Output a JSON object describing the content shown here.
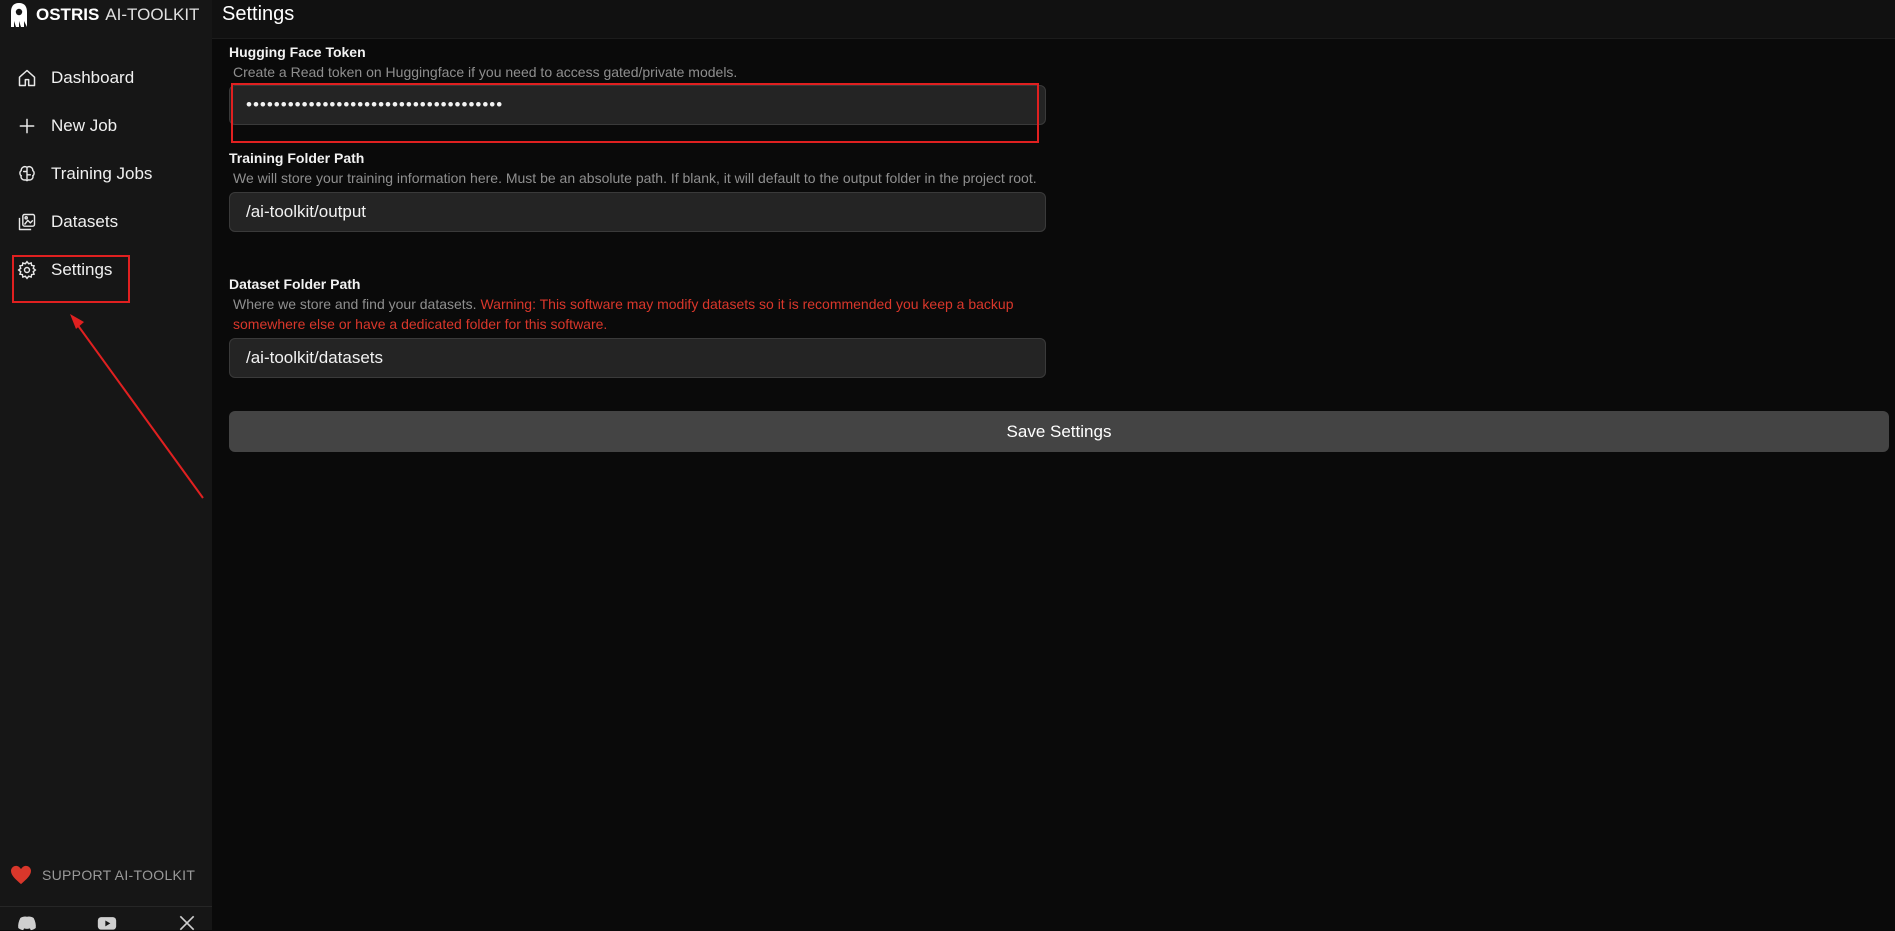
{
  "brand": {
    "name_bold": "OSTRIS",
    "name_rest": "AI-TOOLKIT"
  },
  "header": {
    "title": "Settings"
  },
  "sidebar": {
    "items": [
      {
        "label": "Dashboard",
        "icon": "home-icon"
      },
      {
        "label": "New Job",
        "icon": "plus-icon"
      },
      {
        "label": "Training Jobs",
        "icon": "brain-icon"
      },
      {
        "label": "Datasets",
        "icon": "images-icon"
      },
      {
        "label": "Settings",
        "icon": "gear-icon"
      }
    ],
    "support_label": "SUPPORT AI-TOOLKIT",
    "socials": [
      "discord-icon",
      "youtube-icon",
      "x-icon"
    ]
  },
  "form": {
    "hf_token": {
      "label": "Hugging Face Token",
      "help": "Create a Read token on Huggingface if you need to access gated/private models.",
      "value": "•••••••••••••••••••••••••••••••••••••"
    },
    "training_folder": {
      "label": "Training Folder Path",
      "help": "We will store your training information here. Must be an absolute path. If blank, it will default to the output folder in the project root.",
      "value": "/ai-toolkit/output"
    },
    "dataset_folder": {
      "label": "Dataset Folder Path",
      "help": "Where we store and find your datasets.",
      "warning": "Warning: This software may modify datasets so it is recommended you keep a backup somewhere else or have a dedicated folder for this software.",
      "value": "/ai-toolkit/datasets"
    },
    "save_label": "Save Settings"
  },
  "colors": {
    "annotation": "#e02020",
    "warning": "#d9372b",
    "heart": "#d9372b"
  }
}
